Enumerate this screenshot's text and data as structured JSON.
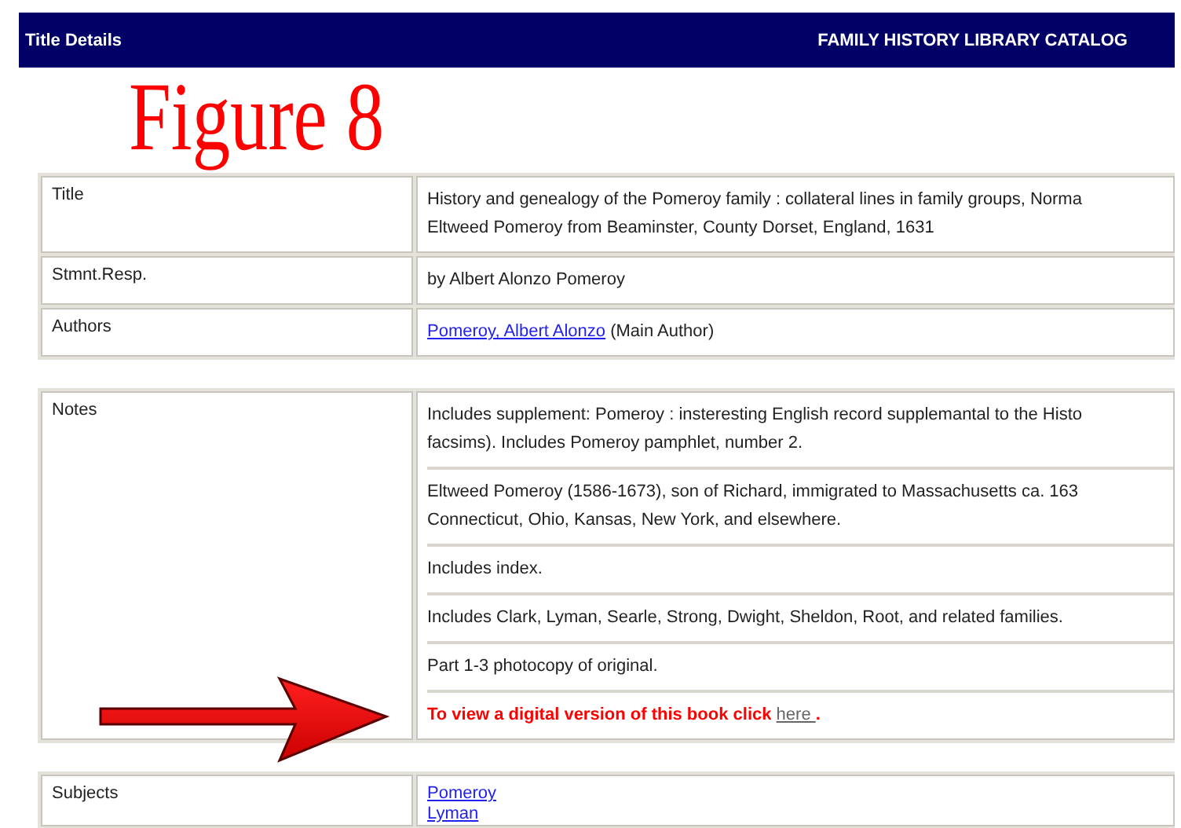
{
  "header": {
    "title": "Title Details",
    "catalog": "FAMILY HISTORY LIBRARY CATALOG"
  },
  "annotation": {
    "figure_label": "Figure 8"
  },
  "tables": [
    {
      "rows": [
        {
          "label": "Title",
          "divided": true,
          "entries": [
            {
              "lines": [
                "History and genealogy of the Pomeroy family : collateral lines in family groups, Norma",
                "Eltweed Pomeroy from Beaminster, County Dorset, England, 1631"
              ]
            }
          ]
        },
        {
          "label": "Stmnt.Resp.",
          "divided": true,
          "entries": [
            {
              "lines": [
                "by Albert Alonzo Pomeroy"
              ]
            }
          ]
        },
        {
          "label": "Authors",
          "divided": true,
          "entries": [
            {
              "lines": [
                [
                  {
                    "kind": "link",
                    "text": "Pomeroy, Albert Alonzo"
                  },
                  {
                    "kind": "text",
                    "text": " (Main Author)"
                  }
                ]
              ]
            }
          ]
        }
      ]
    },
    {
      "rows": [
        {
          "label": "Notes",
          "divided": true,
          "entries": [
            {
              "lines": [
                "Includes supplement: Pomeroy : insteresting English record supplemantal to the Histo",
                "facsims). Includes Pomeroy pamphlet, number 2."
              ]
            },
            {
              "lines": [
                "Eltweed Pomeroy (1586-1673), son of Richard, immigrated to Massachusetts ca. 163",
                "Connecticut, Ohio, Kansas, New York, and elsewhere."
              ]
            },
            {
              "lines": [
                "Includes index."
              ]
            },
            {
              "lines": [
                "Includes Clark, Lyman, Searle, Strong, Dwight, Sheldon, Root, and related families."
              ]
            },
            {
              "lines": [
                "Part 1-3 photocopy of original."
              ]
            },
            {
              "lines": [
                [
                  {
                    "kind": "notice",
                    "text": "To view a digital version of this book click "
                  },
                  {
                    "kind": "dim-link",
                    "text": "here "
                  },
                  {
                    "kind": "notice",
                    "text": "."
                  }
                ]
              ]
            }
          ]
        }
      ]
    },
    {
      "rows": [
        {
          "label": "Subjects",
          "divided": false,
          "entries": [
            {
              "lines": [
                [
                  {
                    "kind": "link",
                    "text": "Pomeroy"
                  }
                ]
              ]
            },
            {
              "lines": [
                [
                  {
                    "kind": "link",
                    "text": "Lyman"
                  }
                ]
              ]
            }
          ]
        }
      ]
    }
  ]
}
